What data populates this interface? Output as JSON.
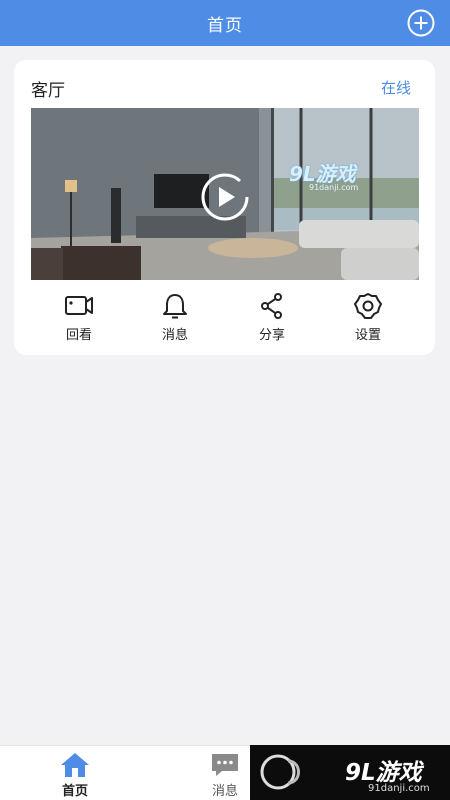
{
  "header": {
    "title": "首页"
  },
  "device_card": {
    "room_name": "客厅",
    "status": "在线",
    "watermark_main": "9L游戏",
    "watermark_sub": "91danji.com",
    "actions": [
      {
        "label": "回看",
        "icon": "video-camera-icon"
      },
      {
        "label": "消息",
        "icon": "bell-icon"
      },
      {
        "label": "分享",
        "icon": "share-icon"
      },
      {
        "label": "设置",
        "icon": "gear-icon"
      }
    ]
  },
  "tabbar": {
    "tabs": [
      {
        "label": "首页",
        "icon": "home-icon",
        "active": true
      },
      {
        "label": "消息",
        "icon": "message-icon",
        "active": false
      }
    ]
  },
  "site_logo": {
    "text": "9L游戏",
    "domain": "91danji.com"
  },
  "colors": {
    "accent": "#4e8ce6",
    "background": "#f2f2f4"
  }
}
